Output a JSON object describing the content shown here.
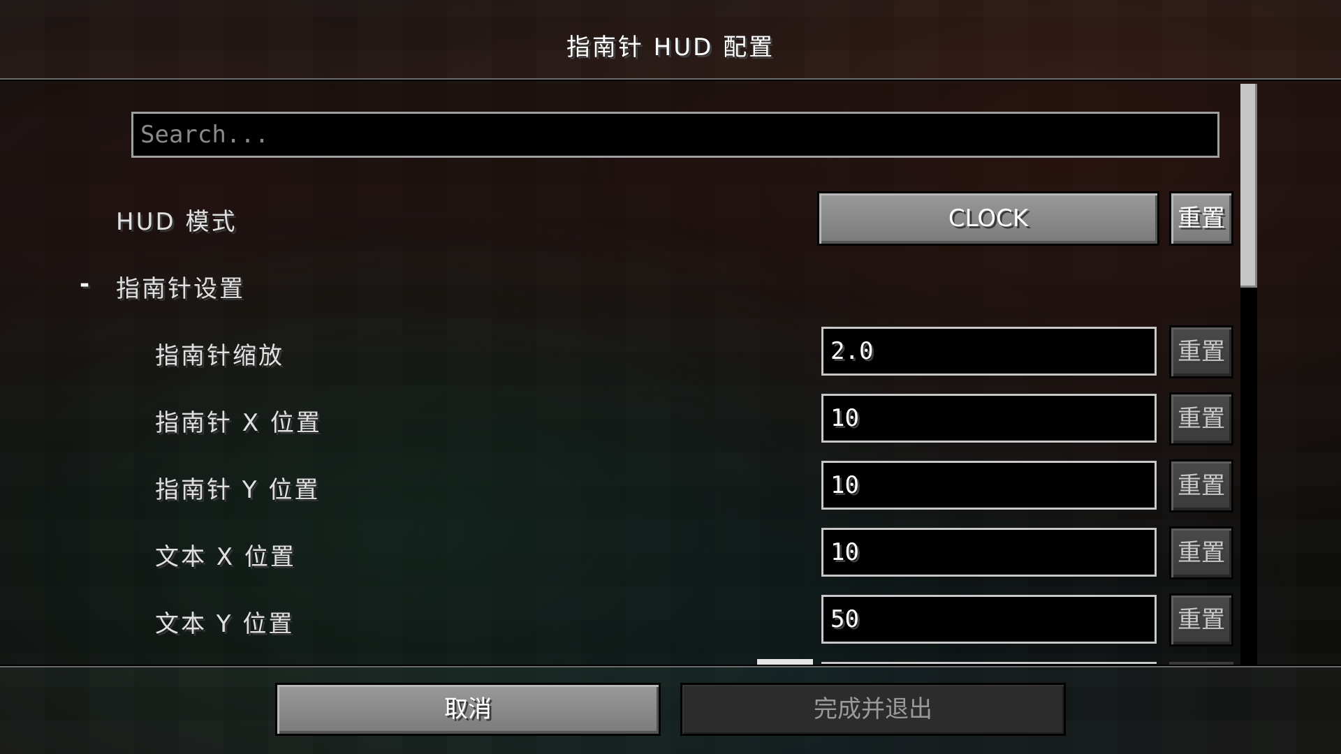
{
  "title": "指南针 HUD 配置",
  "search": {
    "placeholder": "Search..."
  },
  "hud_mode": {
    "label": "HUD 模式",
    "value": "CLOCK",
    "reset_label": "重置"
  },
  "compass_section": {
    "toggle": "-",
    "label": "指南针设置",
    "items": [
      {
        "label": "指南针缩放",
        "value": "2.0",
        "reset_label": "重置"
      },
      {
        "label": "指南针 X 位置",
        "value": "10",
        "reset_label": "重置"
      },
      {
        "label": "指南针 Y 位置",
        "value": "10",
        "reset_label": "重置"
      },
      {
        "label": "文本 X 位置",
        "value": "10",
        "reset_label": "重置"
      },
      {
        "label": "文本 Y 位置",
        "value": "50",
        "reset_label": "重置"
      }
    ]
  },
  "footer": {
    "cancel_label": "取消",
    "done_label": "完成并退出"
  },
  "colors": {
    "field_border": "#c8c8c8",
    "button_gray": "#8a8a8a",
    "text": "#e0e0e0"
  }
}
